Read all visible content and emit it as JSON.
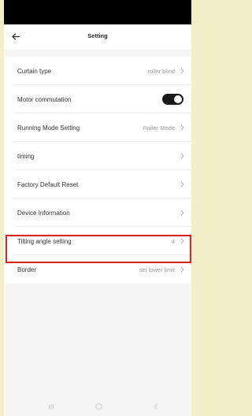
{
  "header": {
    "title": "Setting",
    "back_icon": "arrow-left-icon"
  },
  "settings": {
    "items": [
      {
        "label": "Curtain type",
        "value": "roller blind",
        "control": "chevron"
      },
      {
        "label": "Motor commutation",
        "value": "",
        "control": "toggle",
        "toggle_on": true
      },
      {
        "label": "Running Mode Setting",
        "value": "Roller Mode",
        "control": "chevron"
      },
      {
        "label": "timing",
        "value": "",
        "control": "chevron"
      },
      {
        "label": "Factory Default Reset",
        "value": "",
        "control": "chevron"
      },
      {
        "label": "Device Information",
        "value": "",
        "control": "chevron"
      },
      {
        "label": "Tilting angle setting",
        "value": "4",
        "control": "chevron"
      },
      {
        "label": "Border",
        "value": "set lower limit",
        "control": "chevron",
        "highlighted": true
      }
    ]
  },
  "nav": {
    "recents_icon": "recents-icon",
    "home_icon": "home-icon",
    "back_icon": "nav-back-icon"
  },
  "colors": {
    "highlight": "#e0211f",
    "toggle_on": "#1a1a1a",
    "outer_background": "#f2eec8"
  }
}
